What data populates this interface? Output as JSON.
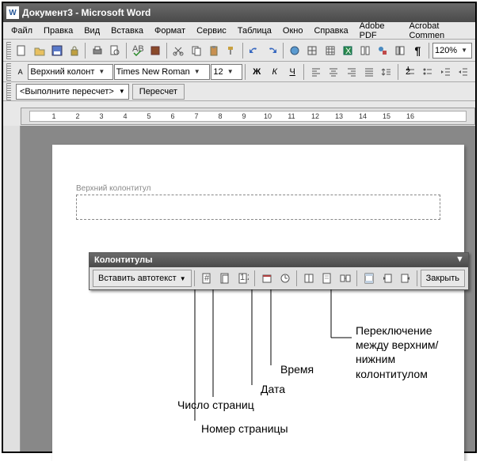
{
  "titlebar": {
    "title": "Документ3 - Microsoft Word",
    "icon_label": "W"
  },
  "menu": {
    "items": [
      "Файл",
      "Правка",
      "Вид",
      "Вставка",
      "Формат",
      "Сервис",
      "Таблица",
      "Окно",
      "Справка",
      "Adobe PDF",
      "Acrobat Commen"
    ]
  },
  "toolbar1": {
    "zoom": "120%"
  },
  "toolbar2": {
    "style": "Верхний колонт",
    "font": "Times New Roman",
    "size": "12",
    "bold": "Ж",
    "italic": "К",
    "underline": "Ч"
  },
  "recalc": {
    "placeholder": "<Выполните пересчет>",
    "button": "Пересчет"
  },
  "header": {
    "label": "Верхний колонтитул"
  },
  "floating": {
    "title": "Колонтитулы",
    "autotext": "Вставить автотекст",
    "close": "Закрыть"
  },
  "callouts": {
    "page_number": "Номер страницы",
    "page_count": "Число страниц",
    "date": "Дата",
    "time": "Время",
    "switch": "Переключение между верхним/ нижним колонтитулом"
  },
  "ruler": {
    "nums": [
      "1",
      "2",
      "3",
      "4",
      "5",
      "6",
      "7",
      "8",
      "9",
      "10",
      "11",
      "12",
      "13",
      "14",
      "15",
      "16"
    ]
  }
}
